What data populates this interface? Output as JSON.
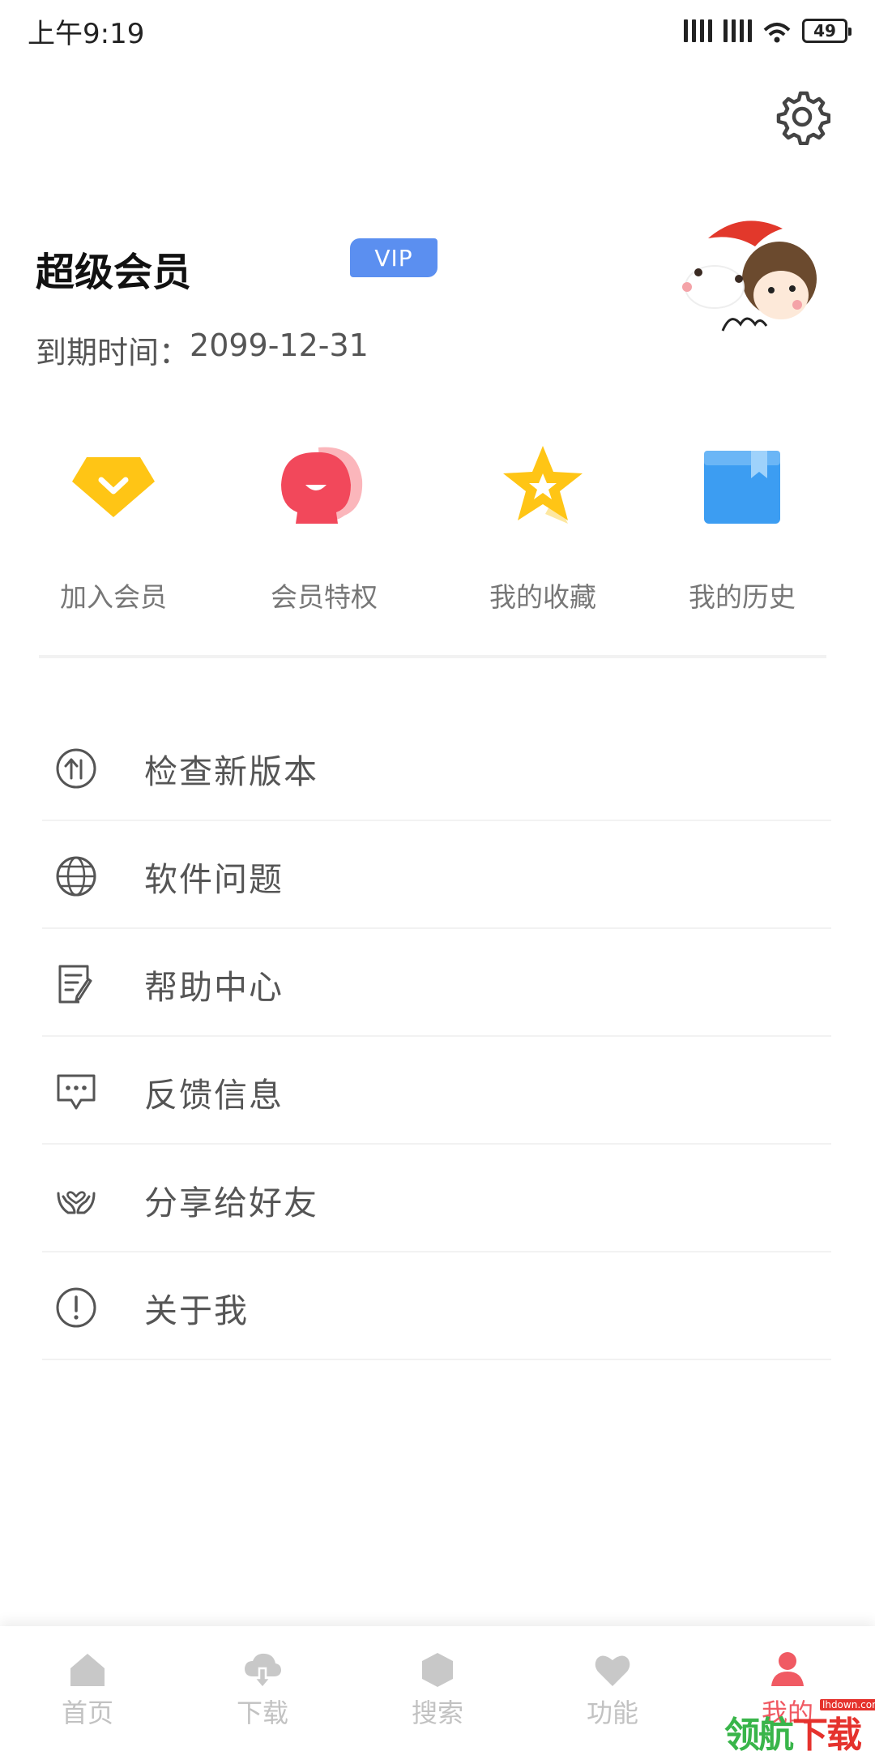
{
  "status_bar": {
    "time": "上午9:19",
    "battery": "49"
  },
  "profile": {
    "title": "超级会员",
    "badge": "VIP",
    "expire_label": "到期时间：",
    "expire_date": "2099-12-31"
  },
  "quick_actions": [
    {
      "label": "加入会员",
      "icon": "diamond-icon"
    },
    {
      "label": "会员特权",
      "icon": "chat-bubble-icon"
    },
    {
      "label": "我的收藏",
      "icon": "star-icon"
    },
    {
      "label": "我的历史",
      "icon": "history-box-icon"
    }
  ],
  "menu": [
    {
      "label": "检查新版本",
      "icon": "upload-circle-icon"
    },
    {
      "label": "软件问题",
      "icon": "globe-icon"
    },
    {
      "label": "帮助中心",
      "icon": "document-edit-icon"
    },
    {
      "label": "反馈信息",
      "icon": "message-icon"
    },
    {
      "label": "分享给好友",
      "icon": "heart-hands-icon"
    },
    {
      "label": "关于我",
      "icon": "info-circle-icon"
    }
  ],
  "tab_bar": [
    {
      "label": "首页",
      "icon": "home-icon"
    },
    {
      "label": "下载",
      "icon": "cloud-download-icon"
    },
    {
      "label": "搜索",
      "icon": "hexagon-icon"
    },
    {
      "label": "功能",
      "icon": "heart-icon"
    },
    {
      "label": "我的",
      "icon": "person-icon",
      "active": true
    }
  ],
  "watermark": {
    "brand_green": "领航",
    "brand_red": "下载",
    "url": "lhdown.com"
  },
  "colors": {
    "vip_badge": "#5b8ff0",
    "active_tab": "#f05a63",
    "inactive_tab": "#c2c2c2",
    "diamond": "#ffc515",
    "chat": "#f2485b",
    "star": "#ffc515",
    "box": "#3c9df2"
  }
}
